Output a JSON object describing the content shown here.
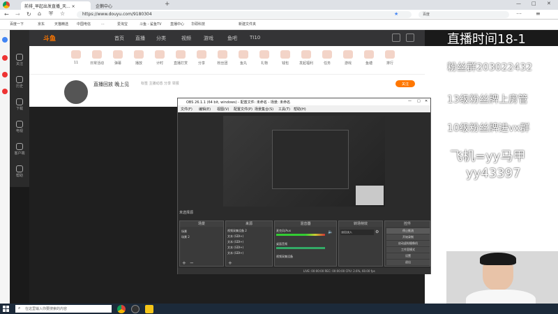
{
  "browser": {
    "tabs": [
      "前排_早起出发直播_天... ×",
      "企鹅中心"
    ],
    "url": "https://www.douyu.com/9180304",
    "bookmarks": [
      "百度一下",
      "京东",
      "天猫精选",
      "中国电信",
      "...",
      "爱淘宝",
      "斗鱼 - 鲨鱼TV",
      "直播中心",
      "华硕科技",
      "新建文件夹"
    ],
    "search_engine": "百度"
  },
  "douyu": {
    "logo": "斗鱼",
    "nav": [
      "首页",
      "直播",
      "分类",
      "视频",
      "游戏",
      "鱼吧",
      "TI10"
    ],
    "side_items": [
      "关注",
      "历史",
      "下载",
      "电视",
      "客户端",
      "帮助"
    ],
    "categories": [
      "11",
      "日常活动",
      "弹幕",
      "播放",
      "计时",
      "直播打赏",
      "分享",
      "粉丝团",
      "鱼丸",
      "礼物",
      "钱包",
      "发起福利",
      "任务",
      "游戏",
      "鱼塘",
      "排行"
    ],
    "room_title": "直播回放 晚上见",
    "room_sub": "标签 主播动态 分享 举报",
    "follow": "关注"
  },
  "obs": {
    "title": "OBS 26.1.1 (64 bit, windows) - 配置文件: 未命名 - 场景: 未命名",
    "menu": [
      "文件(F)",
      "编辑(E)",
      "视图(V)",
      "配置文件(P)",
      "场景集合(S)",
      "工具(T)",
      "帮助(H)"
    ],
    "scenes_label": "未选择源",
    "dock_scenes": "场景",
    "dock_sources": "来源",
    "dock_mixer": "混音器",
    "dock_transitions": "转场特效",
    "dock_controls": "控件",
    "scenes": [
      "场景",
      "场景 2"
    ],
    "sources": [
      "视频采集设备 2",
      "文本 (GDI+)",
      "文本 (GDI+)",
      "文本 (GDI+)",
      "文本 (GDI+)",
      "文本 (GDI+)"
    ],
    "mixer": [
      "麦克风/Aux",
      "桌面音频",
      "视频采集设备"
    ],
    "transition": "淡出淡入",
    "controls": [
      "停止推流",
      "开始录制",
      "启动虚拟摄像机",
      "工作室模式",
      "设置",
      "退出"
    ],
    "status": "LIVE: 00:00:00   REC: 00:00:00   CPU: 2.6%, 60.00 fps"
  },
  "overlay": {
    "lines": [
      "直播时间18-1",
      "粉丝群203022432",
      "13级粉丝牌上房管",
      "10级粉丝牌进vx群",
      "飞机=yy马甲",
      "yy43397"
    ]
  },
  "taskbar": {
    "search_placeholder": "在这里输入你要搜索的内容"
  }
}
